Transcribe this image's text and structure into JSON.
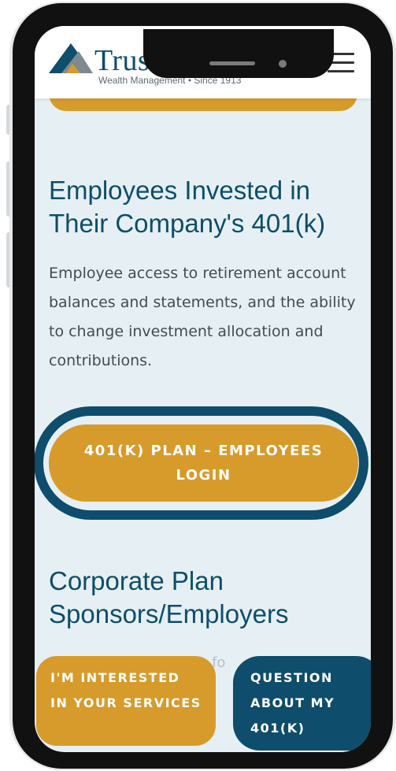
{
  "header": {
    "brand_name": "TrustPoint",
    "tagline": "Wealth Management • Since 1913"
  },
  "employees": {
    "title": "Employees Invested in Their Company's 401(k)",
    "description": "Employee access to retirement account balances and statements, and the ability to change investment allocation and contributions.",
    "login_button": "401(K) PLAN – EMPLOYEES LOGIN"
  },
  "corporate": {
    "title": "Corporate Plan Sponsors/Employers",
    "partial_text": "s fo"
  },
  "cta": {
    "interested": "I'M INTERESTED IN YOUR SERVICES",
    "question": "QUESTION ABOUT MY 401(K)"
  },
  "colors": {
    "brand_blue": "#0e4d6b",
    "accent_gold": "#d79b2b",
    "page_background": "#e6f0f4"
  }
}
